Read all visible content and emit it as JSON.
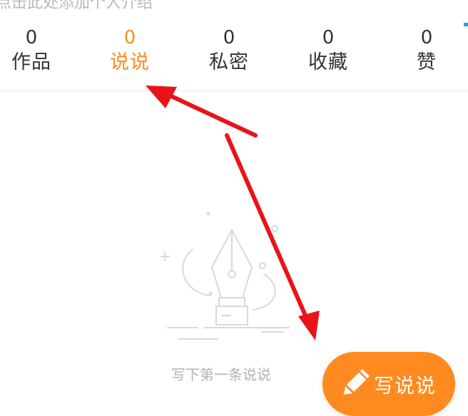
{
  "header": {
    "hint_text": "点击此处添加个人介绍"
  },
  "tabs": [
    {
      "count": "0",
      "label": "作品",
      "active": false
    },
    {
      "count": "0",
      "label": "说说",
      "active": true
    },
    {
      "count": "0",
      "label": "私密",
      "active": false
    },
    {
      "count": "0",
      "label": "收藏",
      "active": false
    },
    {
      "count": "0",
      "label": "赞",
      "active": false
    }
  ],
  "empty_state": {
    "message": "写下第一条说说",
    "icon": "fountain-pen-nib-icon"
  },
  "write_button": {
    "label": "写说说",
    "icon": "pencil-icon"
  },
  "colors": {
    "accent": "#ff8a1f",
    "annotation": "#e8141a",
    "illustration": "#d9d9d9"
  }
}
